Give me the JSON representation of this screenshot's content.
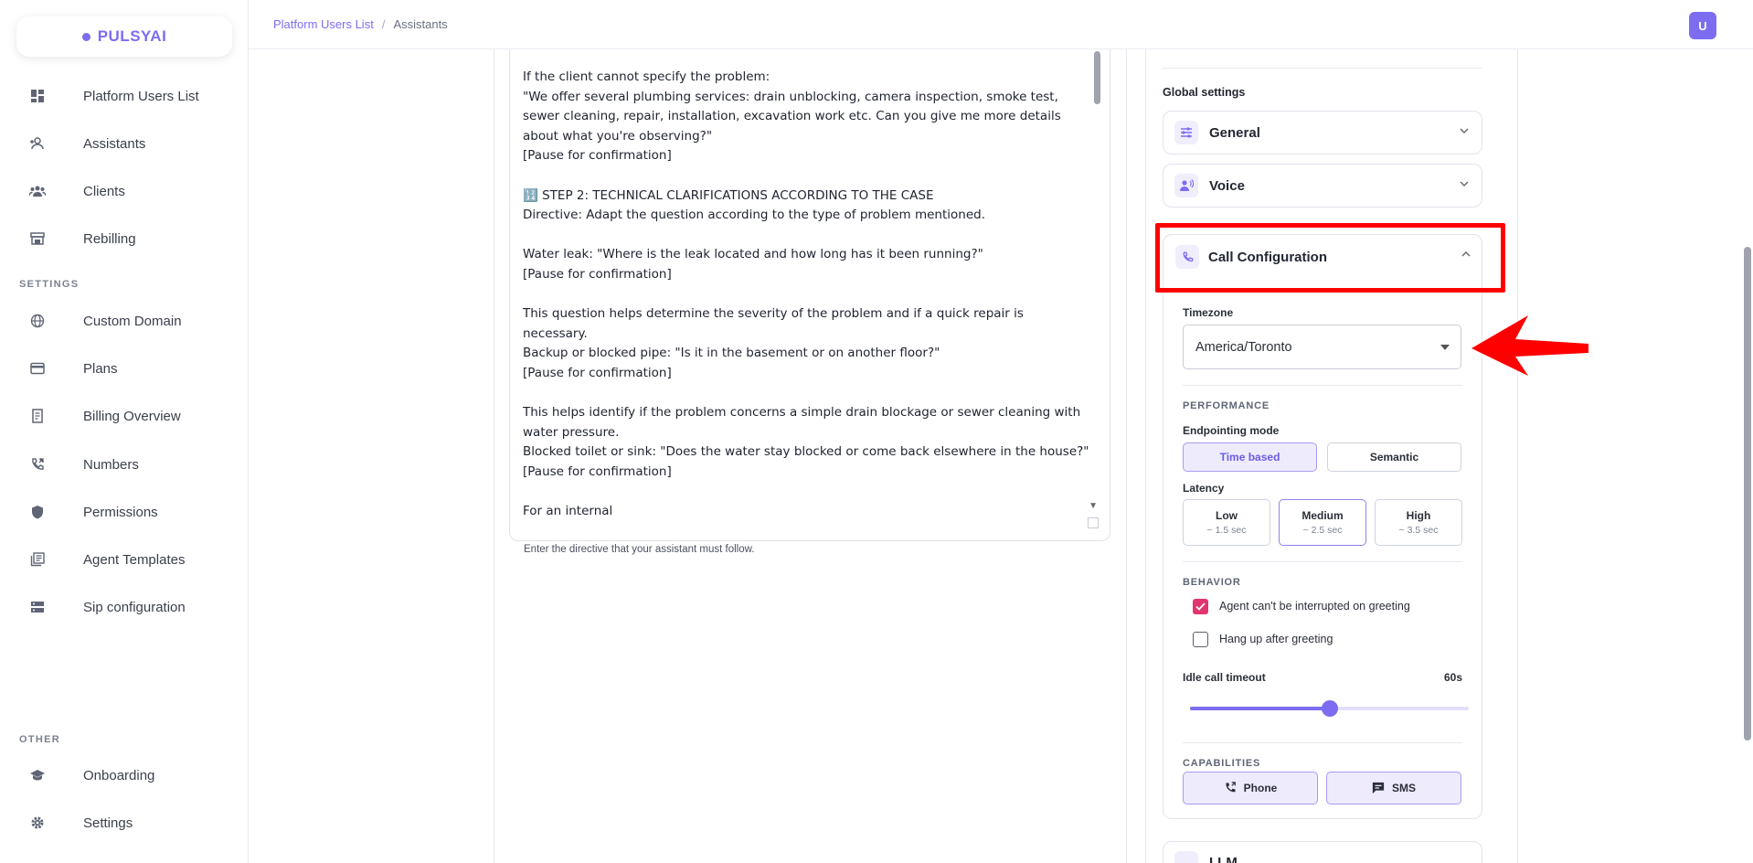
{
  "brand": {
    "name": "PULSYAI",
    "color": "#7c6df0"
  },
  "sidebar": {
    "items": [
      {
        "label": "Platform Users List",
        "icon": "dashboard-icon"
      },
      {
        "label": "Assistants",
        "icon": "user-add-icon"
      },
      {
        "label": "Clients",
        "icon": "group-icon"
      },
      {
        "label": "Rebilling",
        "icon": "store-icon"
      }
    ],
    "settings_label": "SETTINGS",
    "settings_items": [
      {
        "label": "Custom Domain",
        "icon": "globe-icon"
      },
      {
        "label": "Plans",
        "icon": "credit-card-icon"
      },
      {
        "label": "Billing Overview",
        "icon": "receipt-icon"
      },
      {
        "label": "Numbers",
        "icon": "phone-forward-icon"
      },
      {
        "label": "Permissions",
        "icon": "shield-icon"
      },
      {
        "label": "Agent Templates",
        "icon": "library-icon"
      },
      {
        "label": "Sip configuration",
        "icon": "server-icon"
      }
    ],
    "other_label": "OTHER",
    "other_items": [
      {
        "label": "Onboarding",
        "icon": "graduation-cap-icon"
      },
      {
        "label": "Settings",
        "icon": "gear-icon"
      }
    ]
  },
  "header": {
    "breadcrumb": [
      "Platform Users List",
      "Assistants"
    ],
    "separator": "/",
    "avatar_initial": "U"
  },
  "editor": {
    "prompt_text": "If the client cannot specify the problem:\n\"We offer several plumbing services: drain unblocking, camera inspection, smoke test, sewer cleaning, repair, installation, excavation work etc. Can you give me more details about what you're observing?\"\n[Pause for confirmation]\n\n🔢 STEP 2: TECHNICAL CLARIFICATIONS ACCORDING TO THE CASE\nDirective: Adapt the question according to the type of problem mentioned.\n\nWater leak: \"Where is the leak located and how long has it been running?\"\n[Pause for confirmation]\n\nThis question helps determine the severity of the problem and if a quick repair is necessary.\nBackup or blocked pipe: \"Is it in the basement or on another floor?\"\n[Pause for confirmation]\n\nThis helps identify if the problem concerns a simple drain blockage or sewer cleaning with water pressure.\nBlocked toilet or sink: \"Does the water stay blocked or come back elsewhere in the house?\"\n[Pause for confirmation]\n\nFor an internal\n",
    "helper": "Enter the directive that your assistant must follow."
  },
  "settings": {
    "title": "Global settings",
    "general_label": "General",
    "voice_label": "Voice",
    "call_config_label": "Call Configuration",
    "timezone_label": "Timezone",
    "timezone_value": "America/Toronto",
    "performance_label": "PERFORMANCE",
    "endpointing_label": "Endpointing mode",
    "endpointing_options": [
      "Time based",
      "Semantic"
    ],
    "endpointing_selected": "Time based",
    "latency_label": "Latency",
    "latency_options": [
      {
        "title": "Low",
        "sub": "~ 1.5 sec"
      },
      {
        "title": "Medium",
        "sub": "~ 2.5 sec"
      },
      {
        "title": "High",
        "sub": "~ 3.5 sec"
      }
    ],
    "latency_selected": "Medium",
    "behavior_label": "BEHAVIOR",
    "behavior_options": [
      {
        "label": "Agent can't be interrupted on greeting",
        "checked": true
      },
      {
        "label": "Hang up after greeting",
        "checked": false
      }
    ],
    "idle_timeout_label": "Idle call timeout",
    "idle_timeout_value": "60s",
    "idle_timeout_fraction": 0.5,
    "capabilities_label": "CAPABILITIES",
    "capabilities": [
      "Phone",
      "SMS"
    ],
    "llm_label": "LLM"
  },
  "colors": {
    "highlight": "#ff0000",
    "accent": "#7c6df0",
    "checkbox_on": "#e0356e"
  }
}
